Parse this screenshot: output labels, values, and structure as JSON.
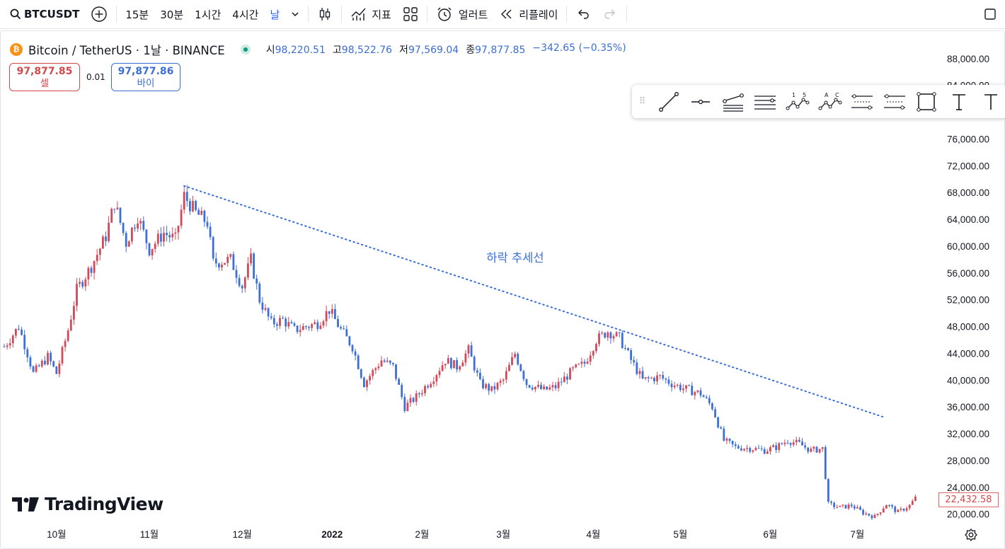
{
  "toolbar": {
    "symbol": "BTCUSDT",
    "intervals": [
      "15분",
      "30분",
      "1시간",
      "4시간",
      "날"
    ],
    "indicators_label": "지표",
    "alert_label": "얼러트",
    "replay_label": "리플레이"
  },
  "legend": {
    "title": "Bitcoin / TetherUS · 1날 · BINANCE",
    "open_label": "시",
    "open": "98,220.51",
    "high_label": "고",
    "high": "98,522.76",
    "low_label": "저",
    "low": "97,569.04",
    "close_label": "종",
    "close": "97,877.85",
    "change": "−342.65 (−0.35%)"
  },
  "trade": {
    "sell_price": "97,877.85",
    "sell_label": "셀",
    "spread": "0.01",
    "buy_price": "97,877.86",
    "buy_label": "바이"
  },
  "logo_text": "TradingView",
  "colors": {
    "up": "#d04a5a",
    "down": "#3d6fd6",
    "trendline": "#3a6ed6",
    "accent": "#2962ff"
  },
  "chart_data": {
    "type": "candlestick",
    "price_axis_labels": [
      "88,000.00",
      "84,000.00",
      "76,000.00",
      "72,000.00",
      "68,000.00",
      "64,000.00",
      "60,000.00",
      "56,000.00",
      "52,000.00",
      "48,000.00",
      "44,000.00",
      "40,000.00",
      "36,000.00",
      "32,000.00",
      "28,000.00",
      "24,000.00",
      "20,000.00"
    ],
    "ylim": [
      18600,
      92000
    ],
    "time_axis_labels": [
      "10월",
      "11월",
      "12월",
      "2022",
      "2월",
      "3월",
      "4월",
      "5월",
      "6월",
      "7월"
    ],
    "last_price": "22,432.58",
    "annotation": "하락 추세선",
    "trendline": {
      "from": {
        "time_index": 62,
        "price": 69000
      },
      "to": {
        "time_index": 303,
        "price": 34500
      }
    },
    "waypoints": [
      [
        0,
        45000
      ],
      [
        5,
        48000
      ],
      [
        8,
        44000
      ],
      [
        10,
        41000
      ],
      [
        15,
        43500
      ],
      [
        18,
        41000
      ],
      [
        22,
        47500
      ],
      [
        25,
        53500
      ],
      [
        30,
        57000
      ],
      [
        35,
        61500
      ],
      [
        38,
        66500
      ],
      [
        42,
        60500
      ],
      [
        46,
        64500
      ],
      [
        50,
        59500
      ],
      [
        55,
        62000
      ],
      [
        59,
        61000
      ],
      [
        62,
        67500
      ],
      [
        66,
        65000
      ],
      [
        70,
        63500
      ],
      [
        72,
        57500
      ],
      [
        78,
        58000
      ],
      [
        82,
        54000
      ],
      [
        85,
        58000
      ],
      [
        88,
        52000
      ],
      [
        92,
        48500
      ],
      [
        96,
        49000
      ],
      [
        100,
        47500
      ],
      [
        104,
        48000
      ],
      [
        108,
        48500
      ],
      [
        112,
        50500
      ],
      [
        116,
        47500
      ],
      [
        120,
        45000
      ],
      [
        124,
        39500
      ],
      [
        130,
        43000
      ],
      [
        134,
        42000
      ],
      [
        138,
        36000
      ],
      [
        142,
        37500
      ],
      [
        148,
        40500
      ],
      [
        152,
        43000
      ],
      [
        156,
        42000
      ],
      [
        160,
        44500
      ],
      [
        164,
        39500
      ],
      [
        168,
        38500
      ],
      [
        172,
        40000
      ],
      [
        176,
        44000
      ],
      [
        180,
        39500
      ],
      [
        186,
        38500
      ],
      [
        190,
        39000
      ],
      [
        196,
        41500
      ],
      [
        200,
        42500
      ],
      [
        204,
        46000
      ],
      [
        208,
        47300
      ],
      [
        212,
        46300
      ],
      [
        216,
        43000
      ],
      [
        220,
        40000
      ],
      [
        226,
        40500
      ],
      [
        230,
        39500
      ],
      [
        234,
        38800
      ],
      [
        240,
        38000
      ],
      [
        244,
        36000
      ],
      [
        248,
        31000
      ],
      [
        252,
        30000
      ],
      [
        258,
        29800
      ],
      [
        262,
        29500
      ],
      [
        266,
        30000
      ],
      [
        270,
        31000
      ],
      [
        274,
        30500
      ],
      [
        278,
        29500
      ],
      [
        282,
        29800
      ],
      [
        284,
        21500
      ],
      [
        288,
        21000
      ],
      [
        292,
        21300
      ],
      [
        296,
        20200
      ],
      [
        300,
        19600
      ],
      [
        304,
        21500
      ],
      [
        308,
        20300
      ],
      [
        312,
        21300
      ],
      [
        314,
        22400
      ]
    ]
  }
}
